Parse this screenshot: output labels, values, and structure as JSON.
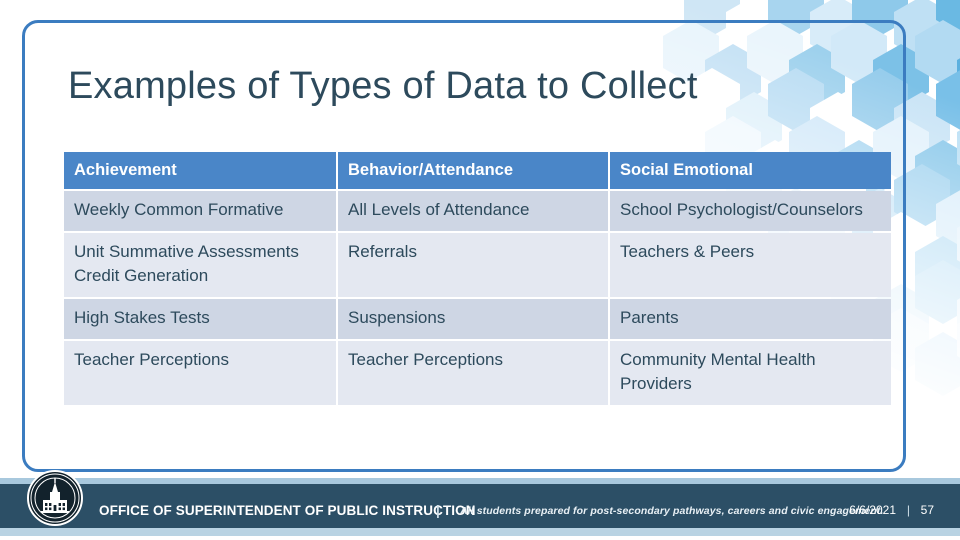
{
  "slide": {
    "title": "Examples of Types of Data to Collect",
    "accent_blue": "#4a86c8",
    "frame_blue": "#3b7cc0",
    "title_color": "#2d4a5c",
    "row_dark": "#ced6e4",
    "row_light": "#e4e8f1",
    "footer_navy": "#2c4f66"
  },
  "table": {
    "headers": [
      "Achievement",
      "Behavior/Attendance",
      "Social Emotional"
    ],
    "rows": [
      {
        "achievement": "Weekly Common Formative",
        "behavior": "All Levels of Attendance",
        "social": "School Psychologist/Counselors"
      },
      {
        "achievement": "Unit Summative Assessments Credit Generation",
        "behavior": "Referrals",
        "social": "Teachers & Peers"
      },
      {
        "achievement": "High Stakes Tests",
        "behavior": "Suspensions",
        "social": "Parents"
      },
      {
        "achievement": "Teacher Perceptions",
        "behavior": "Teacher Perceptions",
        "social": "Community Mental Health Providers"
      }
    ]
  },
  "footer": {
    "organization": "OFFICE OF SUPERINTENDENT OF PUBLIC INSTRUCTION",
    "separator": "|",
    "tagline": "All students prepared for post-secondary pathways, careers and civic engagement.",
    "date": "6/6/2021",
    "separator2": "|",
    "page_number": "57",
    "seal_name": "ospi-seal-icon"
  },
  "decoration": {
    "hexagon_pattern": "hexagon-honeycomb-decoration"
  }
}
